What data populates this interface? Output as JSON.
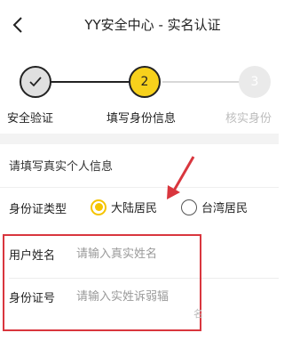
{
  "header": {
    "title": "YY安全中心 - 实名认证",
    "back_icon": "chevron-left-icon"
  },
  "steps": [
    {
      "label": "安全验证",
      "state": "done"
    },
    {
      "label": "填写身份信息",
      "state": "active",
      "number": "2"
    },
    {
      "label": "核实身份",
      "state": "todo",
      "number": "3"
    }
  ],
  "form": {
    "section_title": "请填写真实个人信息",
    "id_type_label": "身份证类型",
    "options": [
      {
        "label": "大陆居民",
        "checked": true
      },
      {
        "label": "台湾居民",
        "checked": false
      }
    ],
    "name_label": "用户姓名",
    "name_placeholder": "请输入真实姓名",
    "id_label": "身份证号",
    "id_placeholder": "请输入实姓诉弱辐"
  },
  "colors": {
    "accent": "#f7d11c",
    "highlight": "#d9363e"
  },
  "watermark": "名"
}
